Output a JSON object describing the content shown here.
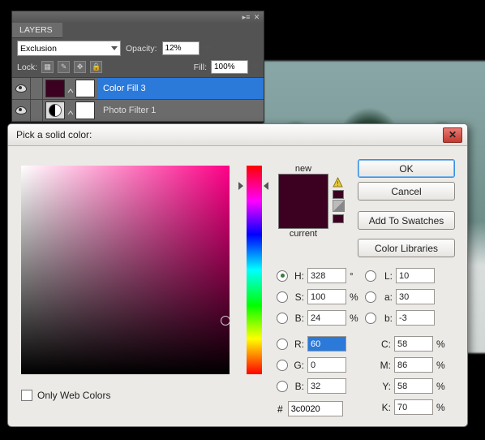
{
  "layers_panel": {
    "tab": "LAYERS",
    "blend_mode": "Exclusion",
    "opacity_label": "Opacity:",
    "opacity_value": "12%",
    "lock_label": "Lock:",
    "fill_label": "Fill:",
    "fill_value": "100%",
    "rows": [
      {
        "name": "Color Fill 3",
        "thumb_color": "#3c0020"
      },
      {
        "name": "Photo Filter 1",
        "thumb_color": ""
      }
    ]
  },
  "color_picker": {
    "title": "Pick a solid color:",
    "new_label": "new",
    "current_label": "current",
    "new_color": "#3c0020",
    "current_color": "#3c0020",
    "buttons": {
      "ok": "OK",
      "cancel": "Cancel",
      "add_swatches": "Add To Swatches",
      "color_libraries": "Color Libraries"
    },
    "hsb": {
      "h": "328",
      "s": "100",
      "b": "24"
    },
    "rgb": {
      "r": "60",
      "g": "0",
      "b": "32"
    },
    "lab": {
      "l": "10",
      "a": "30",
      "b": "-3"
    },
    "cmyk": {
      "c": "58",
      "m": "86",
      "y": "58",
      "k": "70"
    },
    "hex_label": "#",
    "hex": "3c0020",
    "only_web": "Only Web Colors",
    "deg": "°",
    "pct": "%"
  }
}
